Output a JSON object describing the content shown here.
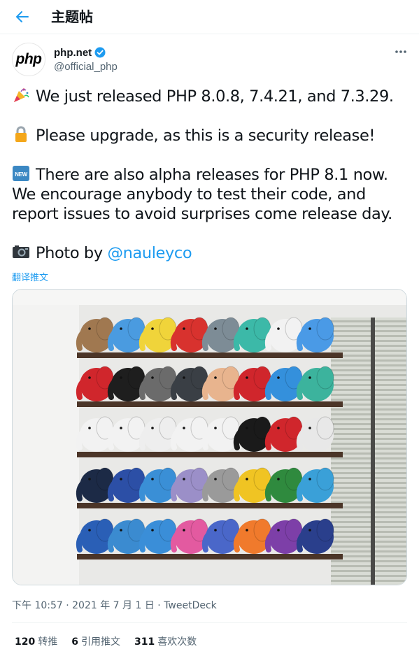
{
  "header": {
    "title": "主题帖",
    "back_icon": "arrow-left-icon",
    "accent_color": "#1d9bf0"
  },
  "author": {
    "avatar_text": "php",
    "name": "php.net",
    "handle": "@official_php",
    "verified_icon": "verified-badge-icon"
  },
  "more_icon": "more-horizontal-icon",
  "tweet": {
    "line1": "We just released PHP 8.0.8, 7.4.21, and 7.3.29.",
    "line1_icon": "party-popper-icon",
    "line2": "Please upgrade, as this is a security release!",
    "line2_icon": "lock-icon",
    "line3": "There are also alpha releases for PHP 8.1 now. We encourage anybody to test their code, and report issues to avoid surprises come release day.",
    "line3_icon": "new-icon",
    "line4_prefix": "Photo by ",
    "line4_icon": "camera-icon",
    "mention": "@nauleyco"
  },
  "translate_label": "翻译推文",
  "photo": {
    "subject": "elephpant-shelves-photo"
  },
  "meta": {
    "text": "下午 10:57 · 2021 年 7 月 1 日 · TweetDeck"
  },
  "stats": {
    "retweets_count": "120",
    "retweets_label": "转推",
    "quotes_count": "6",
    "quotes_label": "引用推文",
    "likes_count": "311",
    "likes_label": "喜欢次数"
  }
}
